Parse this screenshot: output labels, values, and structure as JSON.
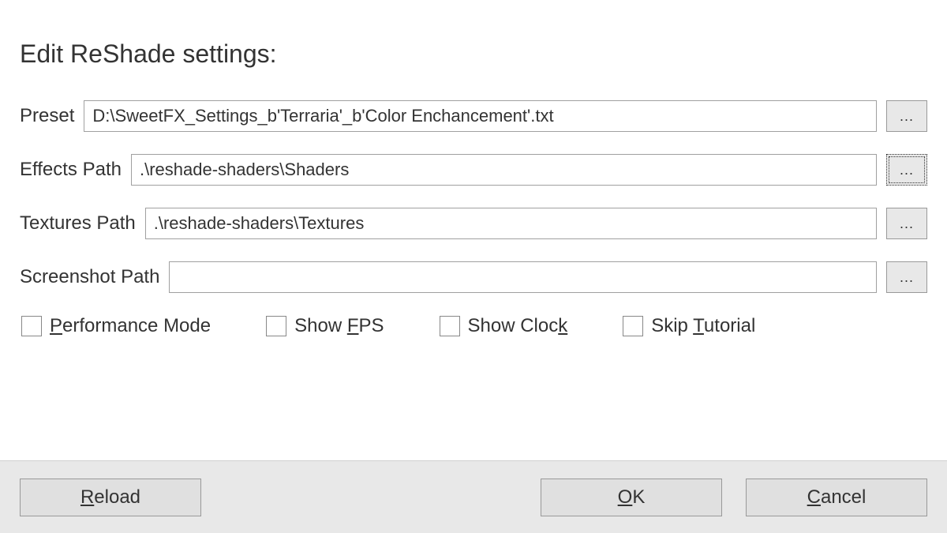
{
  "title": "Edit ReShade settings:",
  "fields": {
    "preset": {
      "label": "Preset",
      "value": "D:\\SweetFX_Settings_b'Terraria'_b'Color Enchancement'.txt",
      "browse": "..."
    },
    "effects": {
      "label": "Effects Path",
      "value": ".\\reshade-shaders\\Shaders",
      "browse": "..."
    },
    "textures": {
      "label": "Textures Path",
      "value": ".\\reshade-shaders\\Textures",
      "browse": "..."
    },
    "screenshot": {
      "label": "Screenshot Path",
      "value": "",
      "browse": "..."
    }
  },
  "checkboxes": {
    "performance": {
      "pre": "",
      "u": "P",
      "post": "erformance Mode",
      "checked": false
    },
    "fps": {
      "pre": "Show ",
      "u": "F",
      "post": "PS",
      "checked": false
    },
    "clock": {
      "pre": "Show Cloc",
      "u": "k",
      "post": "",
      "checked": false
    },
    "tutorial": {
      "pre": "Skip ",
      "u": "T",
      "post": "utorial",
      "checked": false
    }
  },
  "buttons": {
    "reload": {
      "pre": "",
      "u": "R",
      "post": "eload"
    },
    "ok": {
      "pre": "",
      "u": "O",
      "post": "K"
    },
    "cancel": {
      "pre": "",
      "u": "C",
      "post": "ancel"
    }
  }
}
